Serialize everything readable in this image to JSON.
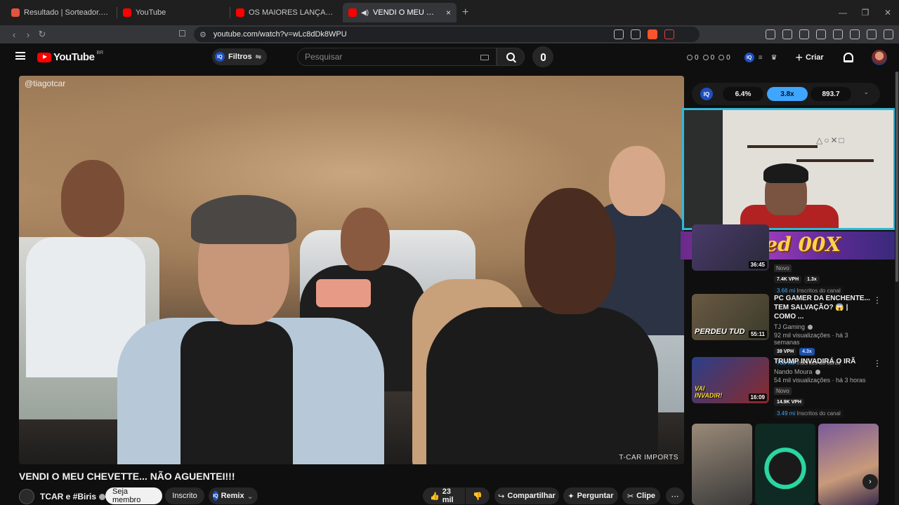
{
  "browser": {
    "tabs": [
      {
        "title": "Resultado | Sorteador.com.br - O Site",
        "favicon_color": "#e2553a",
        "active": false
      },
      {
        "title": "YouTube",
        "favicon_color": "#ff0000",
        "active": false
      },
      {
        "title": "OS MAIORES LANÇAMENTOS DO CHE",
        "favicon_color": "#ff0000",
        "active": false
      },
      {
        "title": "VENDI O MEU CHEVETTE... NÃ",
        "favicon_color": "#ff0000",
        "active": true
      }
    ],
    "url": "youtube.com/watch?v=wLc8dDk8WPU",
    "new_tab": "+",
    "close_glyph": "×"
  },
  "header": {
    "logo_text": "YouTube",
    "country_code": "BR",
    "filtros_label": "Filtros",
    "iq_badge": "IQ",
    "search_placeholder": "Pesquisar",
    "stats": [
      "0",
      "0",
      "0"
    ],
    "create_label": "Criar",
    "create_plus": "+"
  },
  "video": {
    "watermark": "@tiagotcar",
    "brand_watermark": "T-CAR IMPORTS",
    "title": "VENDI O MEU CHEVETTE... NÃO AGUENTEI!!!"
  },
  "owner": {
    "channel_name": "TCAR e #Biris",
    "member_label": "Seja membro",
    "subscribed_label": "Inscrito",
    "remix_label": "Remix",
    "remix_chevron": "⌄",
    "like_count": "23 mil",
    "share_label": "Compartilhar",
    "ask_label": "Perguntar",
    "clip_label": "Clipe",
    "more_glyph": "⋯"
  },
  "iq_panel": {
    "badge": "IQ",
    "values": [
      "6.4%",
      "3.8x",
      "893.7"
    ],
    "chevron": "⌄"
  },
  "stream_banner": "Ped 00X",
  "recommendations": [
    {
      "title": "",
      "channel": "",
      "stats": "",
      "tag": "Novo",
      "vph": "7.4K VPH",
      "outlier": "1.3x",
      "subs_value": "3.66 mi",
      "subs_label": "Inscritos do canal",
      "duration": "36:45",
      "overlay": "",
      "thumb_colors": [
        "#4a3a6a",
        "#2a2a3a"
      ]
    },
    {
      "title": "PC GAMER DA ENCHENTE... TEM SALVAÇÃO? 😱 | COMO ...",
      "channel": "TJ Gaming",
      "stats": "92 mil visualizações · há 3 semanas",
      "tag": "",
      "vph": "39 VPH",
      "outlier": "4.3x",
      "subs_value": "708 mil",
      "subs_label": "Inscritos do canal",
      "duration": "55:11",
      "overlay": "PERDEU TUD",
      "thumb_colors": [
        "#6a5a44",
        "#3a3a2a"
      ]
    },
    {
      "title": "TRUMP INVADIRÁ O IRÃ",
      "channel": "Nando Moura",
      "stats": "54 mil visualizações · há 3 horas",
      "tag": "Novo",
      "vph": "14.9K VPH",
      "outlier": "",
      "subs_value": "3.49 mi",
      "subs_label": "Inscritos do canal",
      "duration": "16:09",
      "overlay": "VAI INVADIR!",
      "thumb_colors": [
        "#2a3f8a",
        "#8a2a2a"
      ]
    }
  ],
  "shorts_next": "›",
  "colors": {
    "accent_blue": "#3ea6ff",
    "yt_red": "#ff0000",
    "webcam_border": "#32b8d8"
  }
}
